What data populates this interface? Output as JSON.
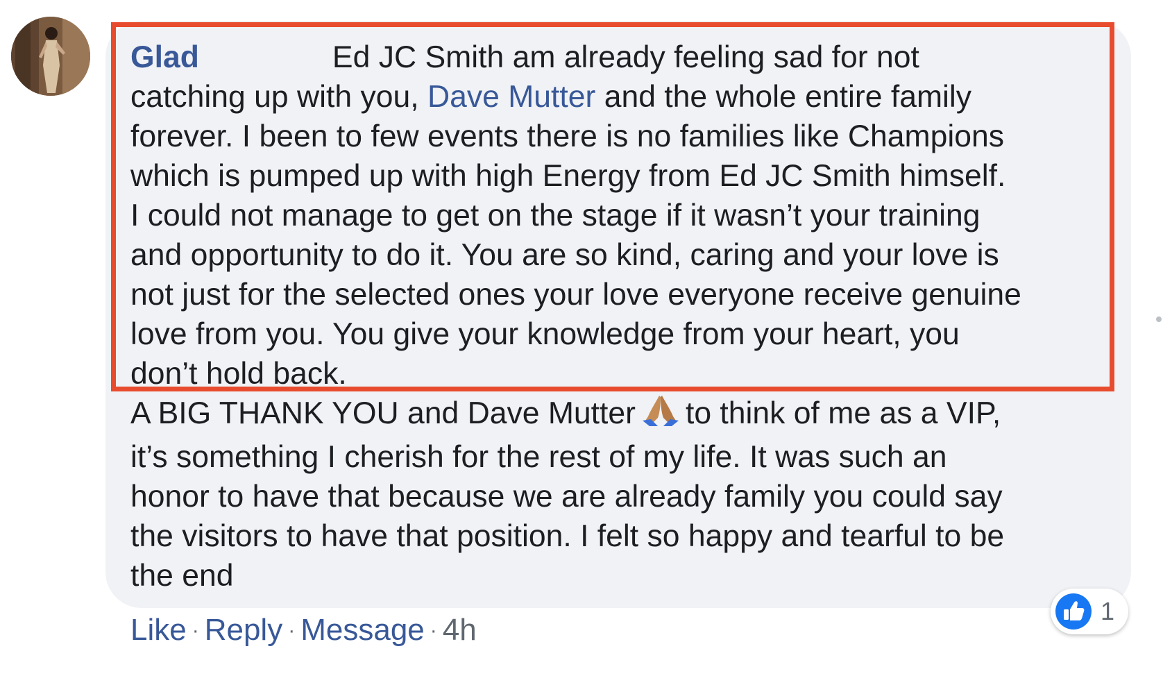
{
  "comment": {
    "author": "Glad",
    "text_part1": "Ed JC Smith am already feeling sad for not\ncatching up with you, ",
    "mention": "Dave Mutter",
    "text_part2": " and the whole entire family\nforever. I been to few events there is no families like Champions\nwhich is pumped up with high Energy from Ed JC Smith himself.\nI could not manage to get on the stage if it wasn’t your training\nand opportunity to do it. You are so kind, caring and your love is\nnot just for the selected ones your love everyone receive genuine\nlove from you. You give your knowledge from your heart, you\ndon’t hold back.\nA BIG THANK YOU and Dave Mutter",
    "text_part3": "to think of me as a VIP,\nit’s something I cherish for the rest of my life. It was such an\nhonor to have that because we are already family you could say\nthe visitors to have that position. I felt so happy and tearful to be\nthe end",
    "emoji_icon": "folded-hands-icon"
  },
  "actions": {
    "like": "Like",
    "reply": "Reply",
    "message": "Message",
    "separator": "·",
    "time": "4h"
  },
  "reactions": {
    "icon": "thumbs-up-icon",
    "count": "1",
    "color": "#1877f2"
  },
  "highlight": {
    "color": "#e74c2e"
  }
}
